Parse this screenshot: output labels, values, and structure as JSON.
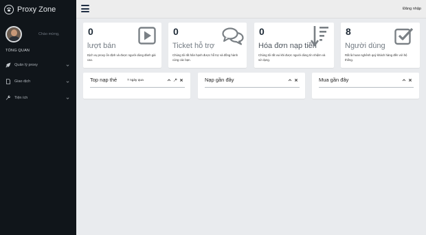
{
  "brand": {
    "name": "Proxy Zone",
    "icon": "paw-icon"
  },
  "user": {
    "welcome": "Chào mừng,"
  },
  "sidebar": {
    "section_title": "TỔNG QUAN",
    "items": [
      {
        "label": "Quản lý proxy",
        "icon": "rocket-icon"
      },
      {
        "label": "Giao dịch",
        "icon": "file-icon"
      },
      {
        "label": "Tiện ích",
        "icon": "wrench-icon"
      }
    ]
  },
  "topbar": {
    "login_label": "Đăng nhập"
  },
  "stats": [
    {
      "number": "0",
      "label": "lượt bán",
      "description": "Dịch vụ proxy ổn định và được người dùng đánh giá cao.",
      "icon": "play-icon"
    },
    {
      "number": "0",
      "label": "Ticket hỗ trợ",
      "description": "Chúng tôi rất hân hạnh được hỗ trợ và đồng hành cùng các bạn.",
      "icon": "comments-icon"
    },
    {
      "number": "0",
      "label": "Hóa đơn nạp tiền",
      "description": "Chúng tôi rất vui khi được người dùng tín nhiệm và sử dụng.",
      "icon": "sort-amount-icon"
    },
    {
      "number": "8",
      "label": "Người dùng",
      "description": "Rất là hoan nghênh quý khách hàng đến với hệ thống.",
      "icon": "check-square-icon"
    }
  ],
  "panels": [
    {
      "title": "Top nạp thẻ",
      "subtitle": "7 ngày qua"
    },
    {
      "title": "Nạp gần đây"
    },
    {
      "title": "Mua gần đây"
    }
  ],
  "colors": {
    "sidebar_bg": "#10151a",
    "topbar_bg": "#ededed",
    "content_bg": "#e9ebee",
    "icon_gray": "#7a8085"
  }
}
